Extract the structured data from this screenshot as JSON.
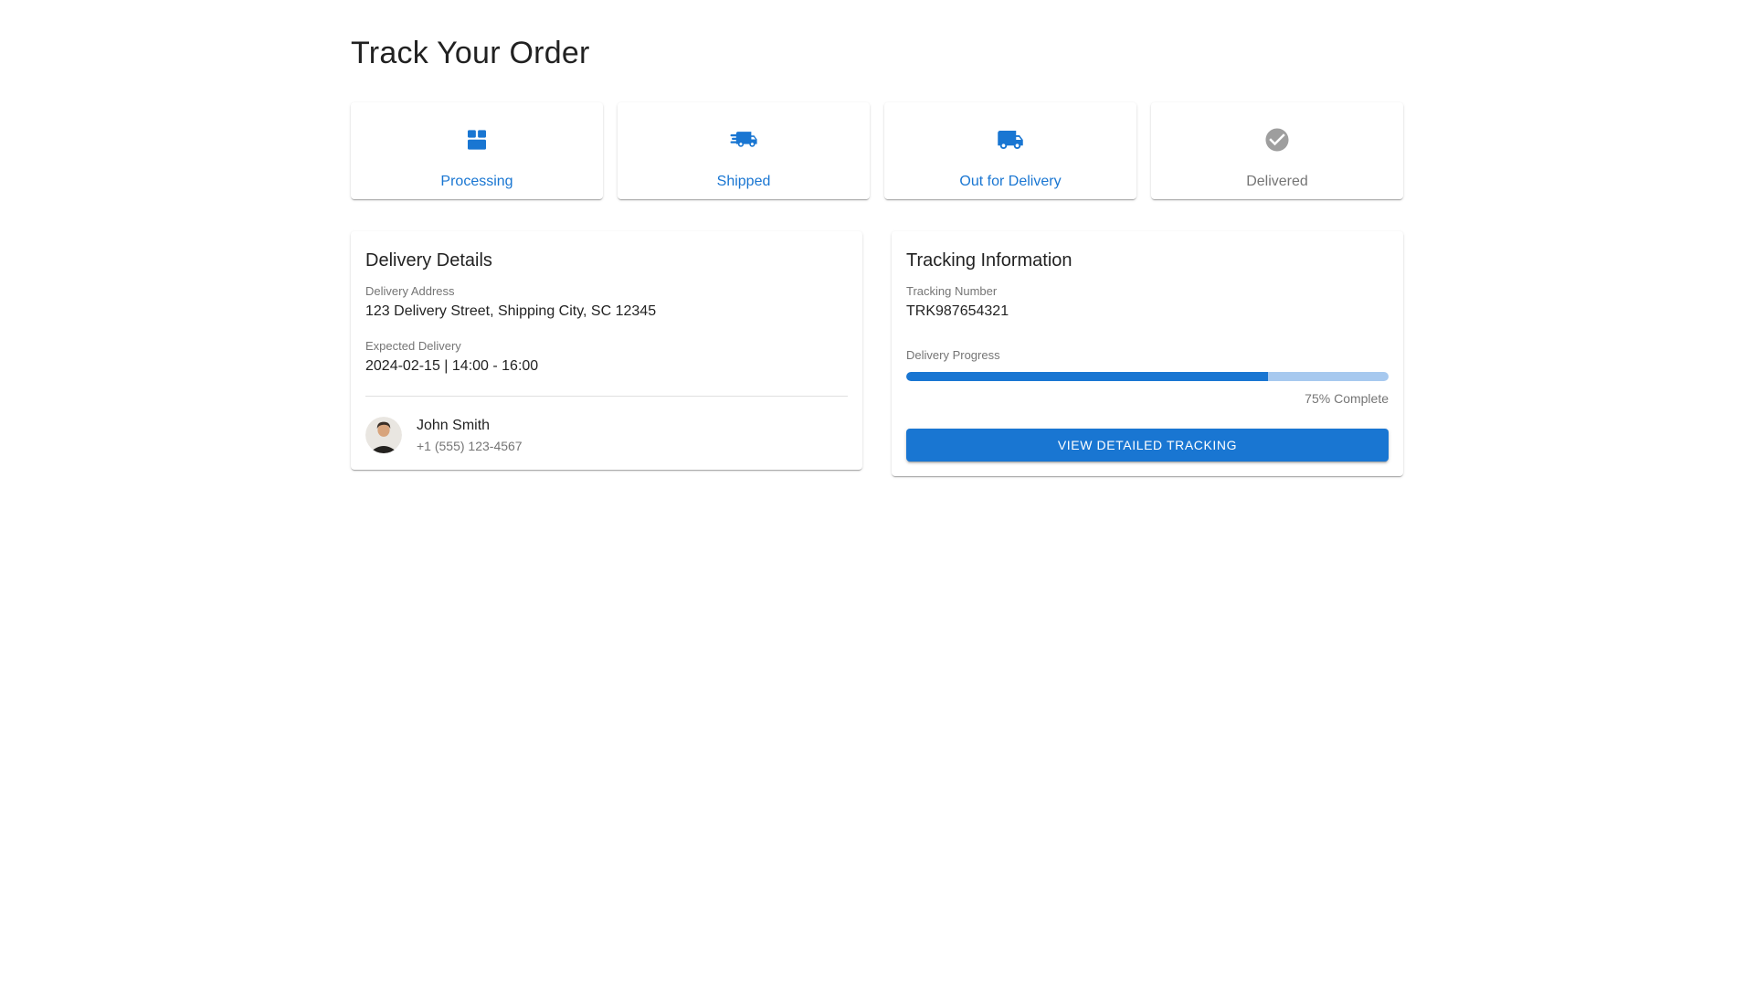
{
  "page": {
    "title": "Track Your Order"
  },
  "colors": {
    "primary_blue": "#1976d2",
    "progress_track_blue": "#a7c9ef",
    "inactive_icon_gray": "#9e9e9e",
    "secondary_text_gray": "#757575"
  },
  "status_steps": [
    {
      "label": "Processing",
      "icon": "package-icon",
      "state": "active"
    },
    {
      "label": "Shipped",
      "icon": "truck-fast-icon",
      "state": "active"
    },
    {
      "label": "Out for Delivery",
      "icon": "truck-icon",
      "state": "active"
    },
    {
      "label": "Delivered",
      "icon": "check-circle-icon",
      "state": "inactive"
    }
  ],
  "delivery_details": {
    "heading": "Delivery Details",
    "address_label": "Delivery Address",
    "address_value": "123 Delivery Street, Shipping City, SC 12345",
    "expected_label": "Expected Delivery",
    "expected_value": "2024-02-15 | 14:00 - 16:00",
    "contact": {
      "name": "John Smith",
      "phone": "+1 (555) 123-4567"
    }
  },
  "tracking": {
    "heading": "Tracking Information",
    "number_label": "Tracking Number",
    "number_value": "TRK987654321",
    "progress_label": "Delivery Progress",
    "progress_percent": 75,
    "progress_text": "75% Complete",
    "button_label": "VIEW DETAILED TRACKING"
  }
}
